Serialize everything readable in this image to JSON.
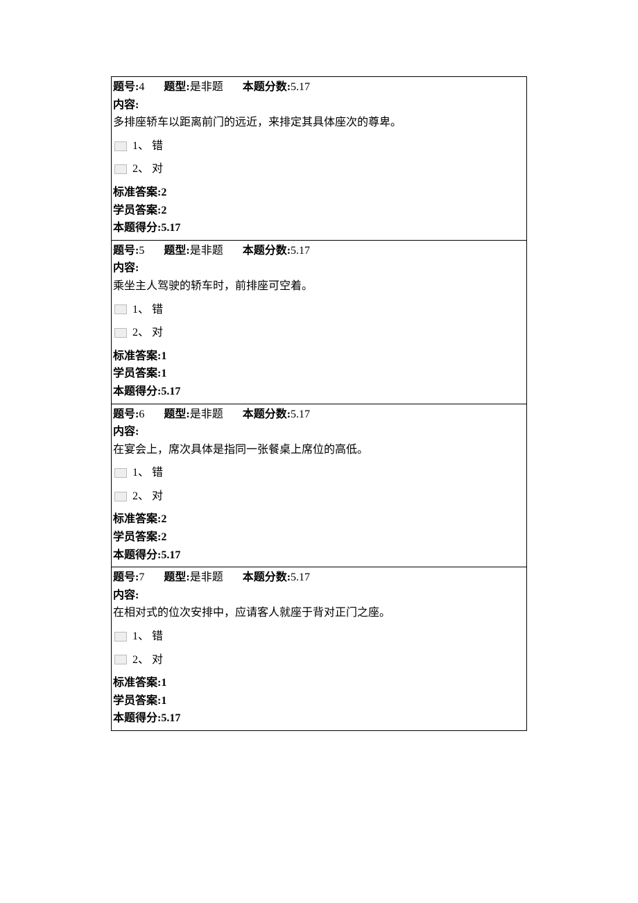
{
  "labels": {
    "qnum": "题号:",
    "qtype_label": "题型:",
    "qscore_label": "本题分数:",
    "content": "内容:",
    "std_answer": "标准答案:",
    "stu_answer": "学员答案:",
    "got_score": "本题得分:"
  },
  "questions": [
    {
      "num": "4",
      "type": "是非题",
      "score": "5.17",
      "body": "多排座轿车以距离前门的远近，来排定其具体座次的尊卑。",
      "options": [
        {
          "idx": "1、",
          "text": "错"
        },
        {
          "idx": "2、",
          "text": "对"
        }
      ],
      "std": "2",
      "stu": "2",
      "got": "5.17"
    },
    {
      "num": "5",
      "type": "是非题",
      "score": "5.17",
      "body": "乘坐主人驾驶的轿车时，前排座可空着。",
      "options": [
        {
          "idx": "1、",
          "text": "错"
        },
        {
          "idx": "2、",
          "text": "对"
        }
      ],
      "std": "1",
      "stu": "1",
      "got": "5.17"
    },
    {
      "num": "6",
      "type": "是非题",
      "score": "5.17",
      "body": "在宴会上，席次具体是指同一张餐桌上席位的高低。",
      "options": [
        {
          "idx": "1、",
          "text": "错"
        },
        {
          "idx": "2、",
          "text": "对"
        }
      ],
      "std": "2",
      "stu": "2",
      "got": "5.17"
    },
    {
      "num": "7",
      "type": "是非题",
      "score": "5.17",
      "body": "在相对式的位次安排中，应请客人就座于背对正门之座。",
      "options": [
        {
          "idx": "1、",
          "text": "错"
        },
        {
          "idx": "2、",
          "text": "对"
        }
      ],
      "std": "1",
      "stu": "1",
      "got": "5.17"
    }
  ]
}
